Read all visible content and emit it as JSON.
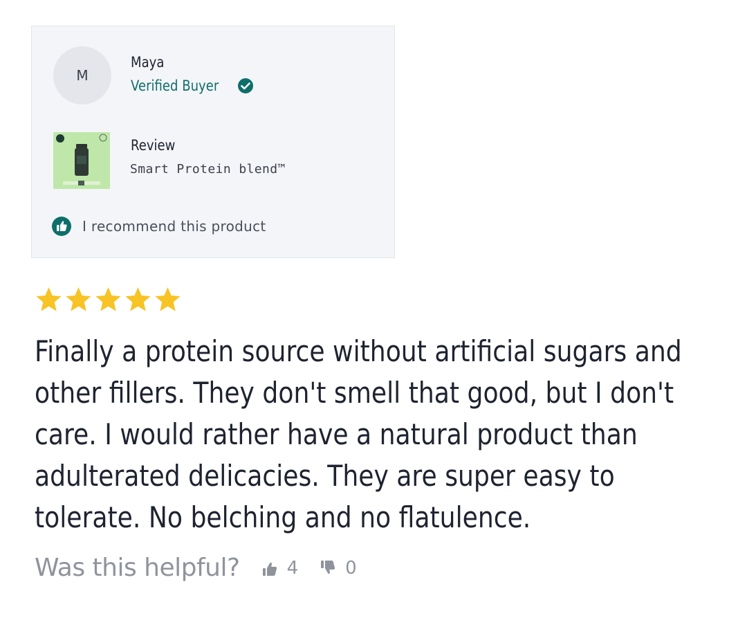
{
  "reviewer": {
    "initial": "M",
    "name": "Maya",
    "badge": "Verified Buyer",
    "badge_icon": "check-circle-icon"
  },
  "product": {
    "label": "Review",
    "name": "Smart Protein blend™",
    "thumbnail": "product-bottle-thumbnail"
  },
  "recommendation": {
    "text": "I recommend this product",
    "icon": "thumbs-up-circle-icon"
  },
  "rating": {
    "value": 5,
    "max": 5
  },
  "review": {
    "text": "Finally a protein source without artificial sugars and other fillers. They don't smell that good, but I don't care. I would rather have a natural product than adulterated delicacies. They are super easy to tolerate. No belching and no flatulence."
  },
  "helpful": {
    "question": "Was this helpful?",
    "upvotes": "4",
    "downvotes": "0"
  },
  "colors": {
    "accent": "#0e6f6a",
    "star": "#f7c325",
    "card_background": "#f4f5f8",
    "muted": "#8f939c"
  }
}
